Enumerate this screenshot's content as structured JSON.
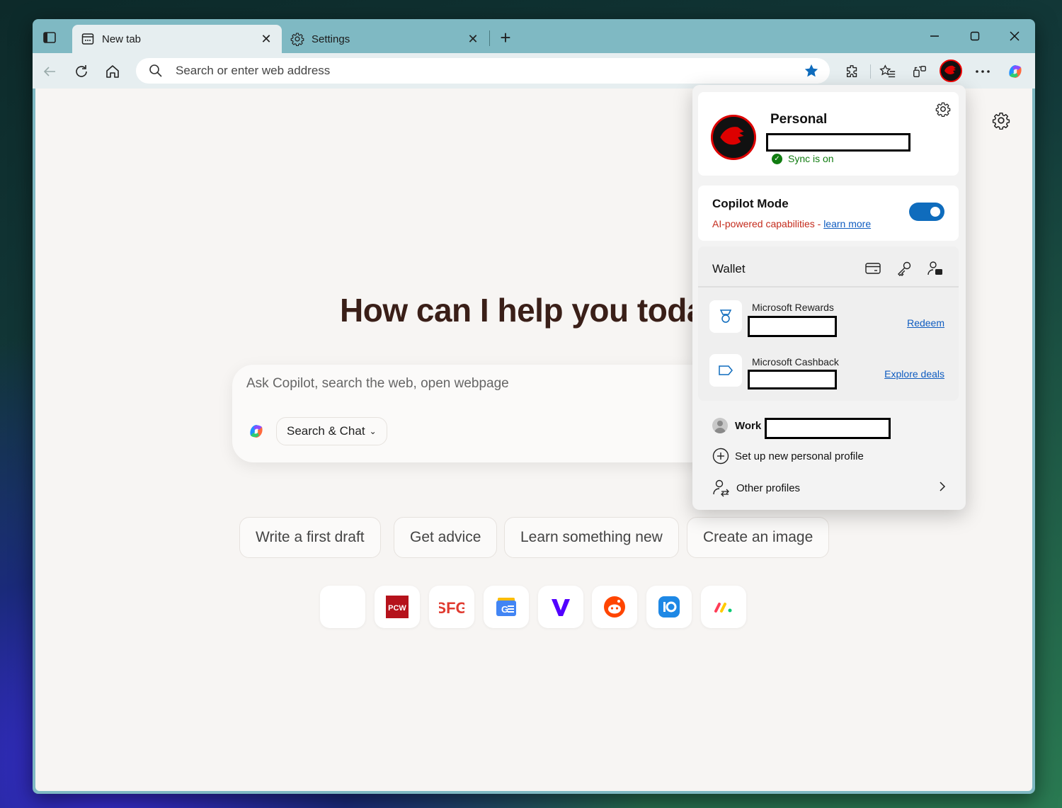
{
  "browser": {
    "tabs": [
      {
        "title": "New tab",
        "active": true
      },
      {
        "title": "Settings",
        "active": false
      }
    ],
    "address_placeholder": "Search or enter web address"
  },
  "ntp": {
    "headline": "How can I help you toda",
    "ask_placeholder": "Ask Copilot, search the web, open webpage",
    "mode_label": "Search & Chat",
    "chips": [
      "Write a first draft",
      "Get advice",
      "Learn something new",
      "Create an image"
    ],
    "quick_links": [
      "blank",
      "PCW",
      "SFG",
      "google-news",
      "verge",
      "reddit",
      "mio",
      "monday"
    ]
  },
  "profile_flyout": {
    "profile_name": "Personal",
    "sync_status": "Sync is on",
    "copilot_mode": {
      "title": "Copilot Mode",
      "subtitle": "AI-powered capabilities - ",
      "link": "learn more",
      "enabled": true
    },
    "wallet": {
      "title": "Wallet",
      "rows": [
        {
          "label": "Microsoft Rewards",
          "action": "Redeem"
        },
        {
          "label": "Microsoft Cashback",
          "action": "Explore deals"
        }
      ]
    },
    "work_label": "Work",
    "setup_label": "Set up new personal profile",
    "other_label": "Other profiles"
  },
  "colors": {
    "accent": "#0f6cbd",
    "sync_green": "#107c10",
    "copilot_red": "#c42b1c"
  }
}
